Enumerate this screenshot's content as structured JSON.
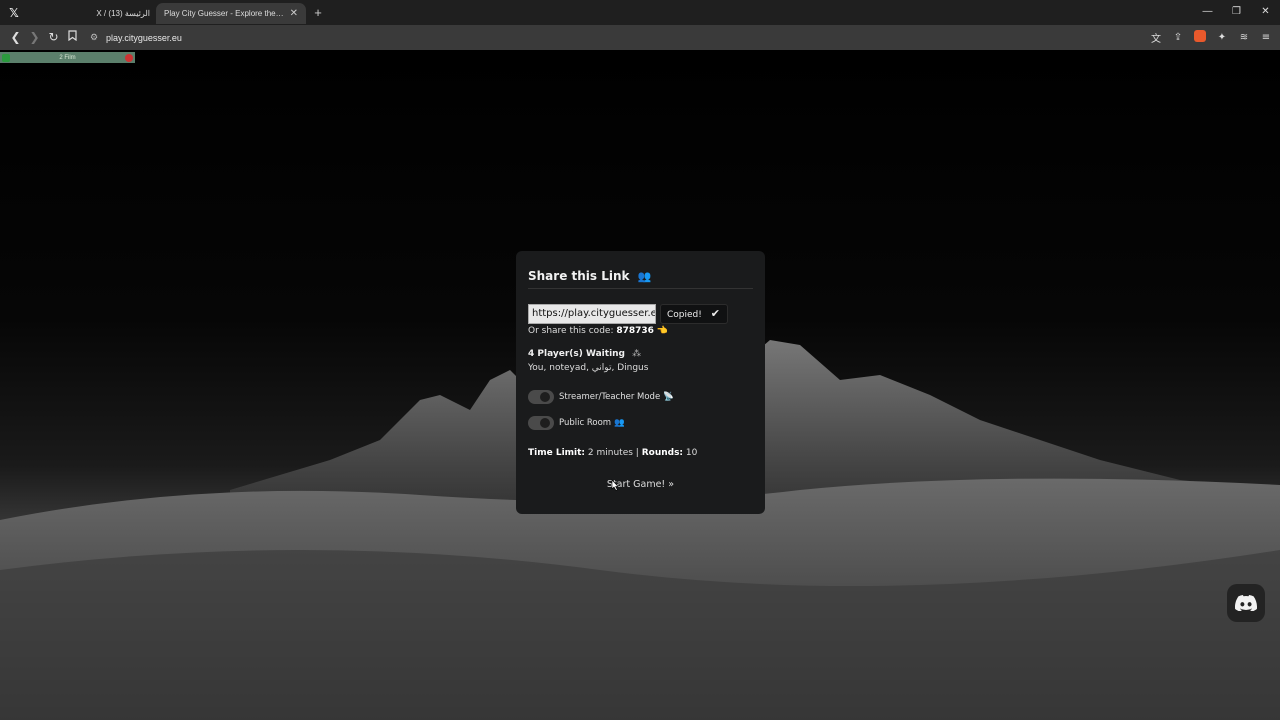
{
  "browser": {
    "tabs": [
      {
        "title": "X / الرئيسة (13)",
        "active": false
      },
      {
        "title": "Play City Guesser - Explore the W",
        "active": true
      }
    ],
    "url": "play.cityguesser.eu",
    "x_logo": "𝕏"
  },
  "extension_bar": {
    "label": "2 Film"
  },
  "modal": {
    "title": "Share this Link",
    "link_value": "https://play.cityguesser.eu",
    "copy_label": "Copied!",
    "share_code_prefix": "Or share this code:",
    "share_code": "878736",
    "players_waiting": "4 Player(s) Waiting",
    "players_list": "You, noteyad, تواني, Dingus",
    "streamer_mode_label": "Streamer/Teacher Mode",
    "streamer_mode_on": false,
    "public_room_label": "Public Room",
    "public_room_on": false,
    "time_limit_label": "Time Limit:",
    "time_limit_value": "2 minutes",
    "rounds_label": "Rounds:",
    "rounds_value": "10",
    "start_label": "Start Game!"
  },
  "icons": {
    "players": "users-icon",
    "discord": "discord-icon"
  }
}
